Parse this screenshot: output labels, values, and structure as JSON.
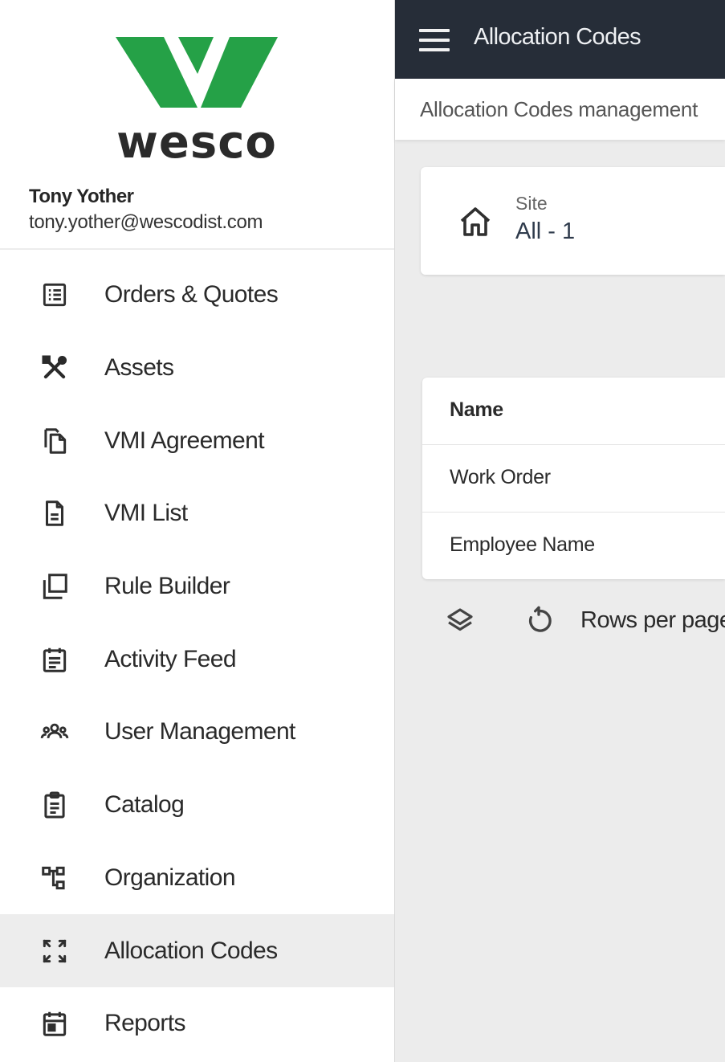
{
  "brand": {
    "name": "wesco",
    "logo_color": "#25a147"
  },
  "user": {
    "name": "Tony Yother",
    "email": "tony.yother@wescodist.com"
  },
  "sidebar": {
    "items": [
      {
        "label": "Orders & Quotes",
        "icon": "list-icon"
      },
      {
        "label": "Assets",
        "icon": "tools-icon"
      },
      {
        "label": "VMI Agreement",
        "icon": "copy-icon"
      },
      {
        "label": "VMI List",
        "icon": "document-icon"
      },
      {
        "label": "Rule Builder",
        "icon": "layers-icon"
      },
      {
        "label": "Activity Feed",
        "icon": "calendar-icon"
      },
      {
        "label": "User Management",
        "icon": "users-icon"
      },
      {
        "label": "Catalog",
        "icon": "clipboard-icon"
      },
      {
        "label": "Organization",
        "icon": "org-chart-icon"
      },
      {
        "label": "Allocation Codes",
        "icon": "expand-icon",
        "active": true
      },
      {
        "label": "Reports",
        "icon": "calendar-event-icon"
      }
    ]
  },
  "header": {
    "title": "Allocation Codes",
    "subtitle": "Allocation Codes management",
    "background": "#262d38"
  },
  "site": {
    "label": "Site",
    "value": "All -  1"
  },
  "table": {
    "header": "Name",
    "rows": [
      "Work Order",
      "Employee Name"
    ]
  },
  "footer": {
    "rows_per_page": "Rows per page"
  }
}
